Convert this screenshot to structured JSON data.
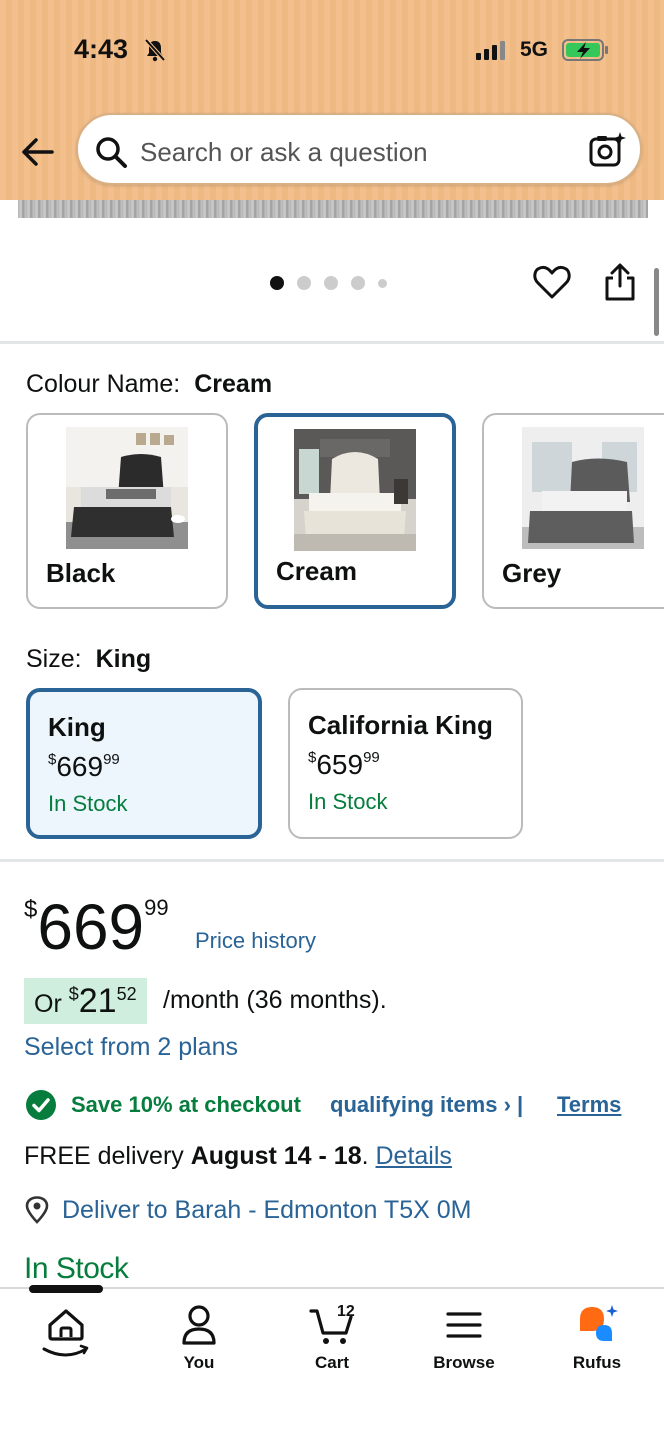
{
  "status_bar": {
    "time": "4:43",
    "network": "5G"
  },
  "search": {
    "placeholder": "Search or ask a question"
  },
  "carousel": {
    "dot_count": 5,
    "active_dot": 0
  },
  "colour": {
    "label": "Colour Name:",
    "selected": "Cream",
    "options": [
      {
        "name": "Black"
      },
      {
        "name": "Cream"
      },
      {
        "name": "Grey"
      }
    ]
  },
  "size": {
    "label": "Size:",
    "selected": "King",
    "options": [
      {
        "name": "King",
        "price_currency": "$",
        "price_whole": "669",
        "price_fraction": "99",
        "stock": "In Stock"
      },
      {
        "name": "California King",
        "price_currency": "$",
        "price_whole": "659",
        "price_fraction": "99",
        "stock": "In Stock"
      }
    ]
  },
  "price": {
    "currency": "$",
    "whole": "669",
    "fraction": "99",
    "history_link": "Price history",
    "monthly_prefix": "Or",
    "monthly_currency": "$",
    "monthly_whole": "21",
    "monthly_fraction": "52",
    "monthly_suffix": "/month (36 months).",
    "plans_link": "Select from 2 plans"
  },
  "promo": {
    "save_text": "Save 10% at checkout",
    "qualifying_link": "qualifying items › |",
    "terms_link": "Terms"
  },
  "delivery": {
    "prefix": "FREE delivery",
    "dates": "August 14 - 18",
    "details_link": "Details",
    "deliver_to": "Deliver to Barah - Edmonton T5X 0M"
  },
  "availability": "In Stock",
  "bottom_nav": {
    "items": [
      {
        "label": "",
        "icon": "home-icon"
      },
      {
        "label": "You",
        "icon": "user-icon"
      },
      {
        "label": "Cart",
        "icon": "cart-icon",
        "count": "12"
      },
      {
        "label": "Browse",
        "icon": "menu-icon"
      },
      {
        "label": "Rufus",
        "icon": "rufus-icon"
      }
    ]
  },
  "colors": {
    "header_bg": "#f3c08d",
    "link_blue": "#2a6396",
    "stock_green": "#067d3d",
    "selected_border": "#2a6396",
    "selected_bg": "#edf6fd",
    "monthly_badge_bg": "#cfeedd"
  }
}
